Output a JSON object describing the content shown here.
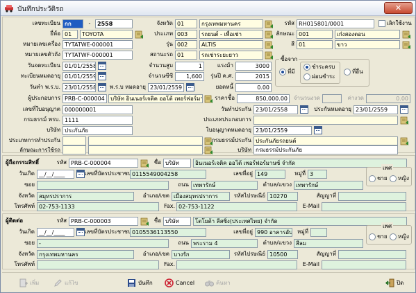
{
  "window": {
    "title": "บันทึกประวัติรถ",
    "close_glyph": "✕"
  },
  "main": {
    "doc_no_label": "เลขทะเบียน",
    "doc_prefix": "กก",
    "doc_dash": "-",
    "doc_no": "2558",
    "province_label": "จังหวัด",
    "province_code": "01",
    "province_name": "กรุงเทพมหานคร",
    "code_label": "รหัส",
    "code_value": "RH015801/0001",
    "cancel_label": "เลิกใช้งาน",
    "brand_label": "ยี่ห้อ",
    "brand_code": "01",
    "brand_name": "TOYOTA",
    "type_label": "ประเภท",
    "type_code": "003",
    "type_name": "รถยนต์ - เพื่อเช่า",
    "usage_label": "ลักษณะ",
    "usage_code": "001",
    "usage_name": "เก๋งสองตอน",
    "chassis_label": "หมายเลขเครื่อง",
    "chassis_no": "TYTATWE-000001",
    "model_label": "รุ่น",
    "model_code": "002",
    "model_name": "ALTIS",
    "color_label": "สี",
    "color_code": "01",
    "color_name": "ขาว",
    "engine_label": "หมายเลขตัวถัง",
    "engine_no": "TYTATWF-000001",
    "status_label": "สถานะรถ",
    "status_code": "01",
    "status_name": "รถเช่าระยะยาว",
    "reg_date_label": "วันจดทะเบียน",
    "reg_date": "01/01/2558",
    "cyl_label": "จำนวนสูบ",
    "cyl_value": "1",
    "power_label": "แรงม้า",
    "power_value": "3000",
    "tax_exp_label": "ทะเบียนหมดอายุ",
    "tax_exp": "01/01/2559",
    "cc_label": "จำนวนซีซี",
    "cc_value": "1,600",
    "year_label": "รุ่นปี ค.ศ.",
    "year_value": "2015",
    "pay_date_label": "วันทำ พ.ร.บ.",
    "pay_date": "23/01/2558",
    "act_exp_label": "พ.ร.บ หมดอายุ",
    "act_exp": "23/01/2559",
    "balance_label": "ยอดหนี้",
    "balance_value": "0.00",
    "source_group_label": "ซื้อจาก",
    "radio_own": "ที่มี",
    "radio_cash": "ชำระครบ",
    "radio_installment": "ผ่อนชำระ",
    "radio_other": "ที่อื่น",
    "insurer_label": "ผู้ประกอบการ",
    "insurer_code": "PRB-C-000004",
    "insurer_name": "บริษัท อินเนอร์เจติค ออโต้ เพอร์ฟอร์มานซ์",
    "price_label": "ราคาซื้อ",
    "price_value": "850,000.00",
    "installments_label": "จำนวนงวด",
    "installments_value": "",
    "per_inst_label": "ค่างวด",
    "per_inst_value": "0.00",
    "license_label": "เลขที่ใบอนุญาต",
    "license_no": "000000001",
    "ins_start_label": "วันทำประกัน",
    "ins_start": "23/01/2558",
    "ins_exp_label": "ประกันหมดอายุ",
    "ins_exp": "23/01/2559",
    "policy_label": "กรมธรรม์ พรบ.",
    "policy_no": "1111",
    "ins_company_label": "ประเภทประกอบการ",
    "ins_company": "",
    "company_label": "บริษัท",
    "company_name": "ประกันภัย",
    "license_exp_label": "ใบอนุญาตหมดอายุ",
    "license_exp": "23/01/2559",
    "ins_type_label": "ประเภทการทำประกัน",
    "ins_type_code": "",
    "ins_type_name": "",
    "coverage_label": "กรมธรรม์ประกัน",
    "coverage_name": "ประกันภัยรถยนต์",
    "use_type_label": "ลักษณะการใช้รถ",
    "use_type_code": "",
    "use_type_name": "",
    "ins_corp_label": "บริษัท",
    "ins_corp_name": "กรมธรรม์ประกันภัย"
  },
  "owner": {
    "title": "ผู้ถือกรรมสิทธิ์",
    "code_label": "รหัส",
    "code_value": "PRB-C-000004",
    "name_label": "ชื่อ",
    "prefix": "บริษัท",
    "name": "อินเนอร์เจติค ออโต้ เพอร์ฟอร์มานซ์ จำกัด",
    "birth_label": "วันเกิด",
    "birth": "__/__/____",
    "taxid_label": "เลขที่บัตรประชาชน",
    "taxid": "0115549004258",
    "house_label": "เลขที่อยู่",
    "house": "149",
    "moo_label": "หมู่ที่",
    "moo": "3",
    "gender_label": "เพศ",
    "male": "ชาย",
    "female": "หญิง",
    "soi_label": "ซอย",
    "soi": "",
    "road_label": "ถนน",
    "road": "เทพารักษ์",
    "tambon_label": "ตำบล/แขวง",
    "tambon": "เทพารักษ์",
    "province_label": "จังหวัด",
    "province": "สมุทรปราการ",
    "amphur_label": "อำเภอ/เขต",
    "amphur": "เมืองสมุทรปราการ",
    "zip_label": "รหัสไปรษณีย์",
    "zip": "10270",
    "contract_label": "สัญญาที่",
    "contract": "",
    "phone_label": "โทรศัพท์",
    "phone": "02-753-1133",
    "fax_label": "Fax.",
    "fax": "02-753-1122",
    "email_label": "E-Mail",
    "email": ""
  },
  "renter": {
    "title": "ผู้ติดต่อ",
    "code_label": "รหัส",
    "code_value": "PRB-C-000003",
    "name_label": "ชื่อ",
    "prefix": "บริษัท",
    "name": "โตโยต้า ลีสซิ่ง(ประเทศไทย) จำกัด",
    "birth_label": "วันเกิด",
    "birth": "__/__/____",
    "taxid_label": "เลขที่บัตรประชาชน",
    "taxid": "0105536113550",
    "house_label": "เลขที่อยู่",
    "house": "990 อาคารอับดุลราฮิม",
    "moo_label": "หมู่ที่",
    "moo": "",
    "gender_label": "เพศ",
    "male": "ชาย",
    "female": "หญิง",
    "soi_label": "ซอย",
    "soi": "-",
    "road_label": "ถนน",
    "road": "พระราม 4",
    "tambon_label": "ตำบล/แขวง",
    "tambon": "สีลม",
    "province_label": "จังหวัด",
    "province": "กรุงเทพมหานคร",
    "amphur_label": "อำเภอ/เขต",
    "amphur": "บางรัก",
    "zip_label": "รหัสไปรษณีย์",
    "zip": "10500",
    "contract_label": "สัญญาที่",
    "contract": "",
    "phone_label": "โทรศัพท์",
    "phone": "",
    "fax_label": "Fax.",
    "fax": "",
    "email_label": "E-Mail",
    "email": ""
  },
  "toolbar": {
    "add": "เพิ่ม",
    "edit": "แก้ไข",
    "save": "บันทึก",
    "cancel": "Cancel",
    "search": "ค้นหา",
    "close": "ปิด"
  },
  "colors": {
    "highlight": "#1f5cc2",
    "yellow_field": "#fffde2",
    "green_field": "#def2de"
  }
}
